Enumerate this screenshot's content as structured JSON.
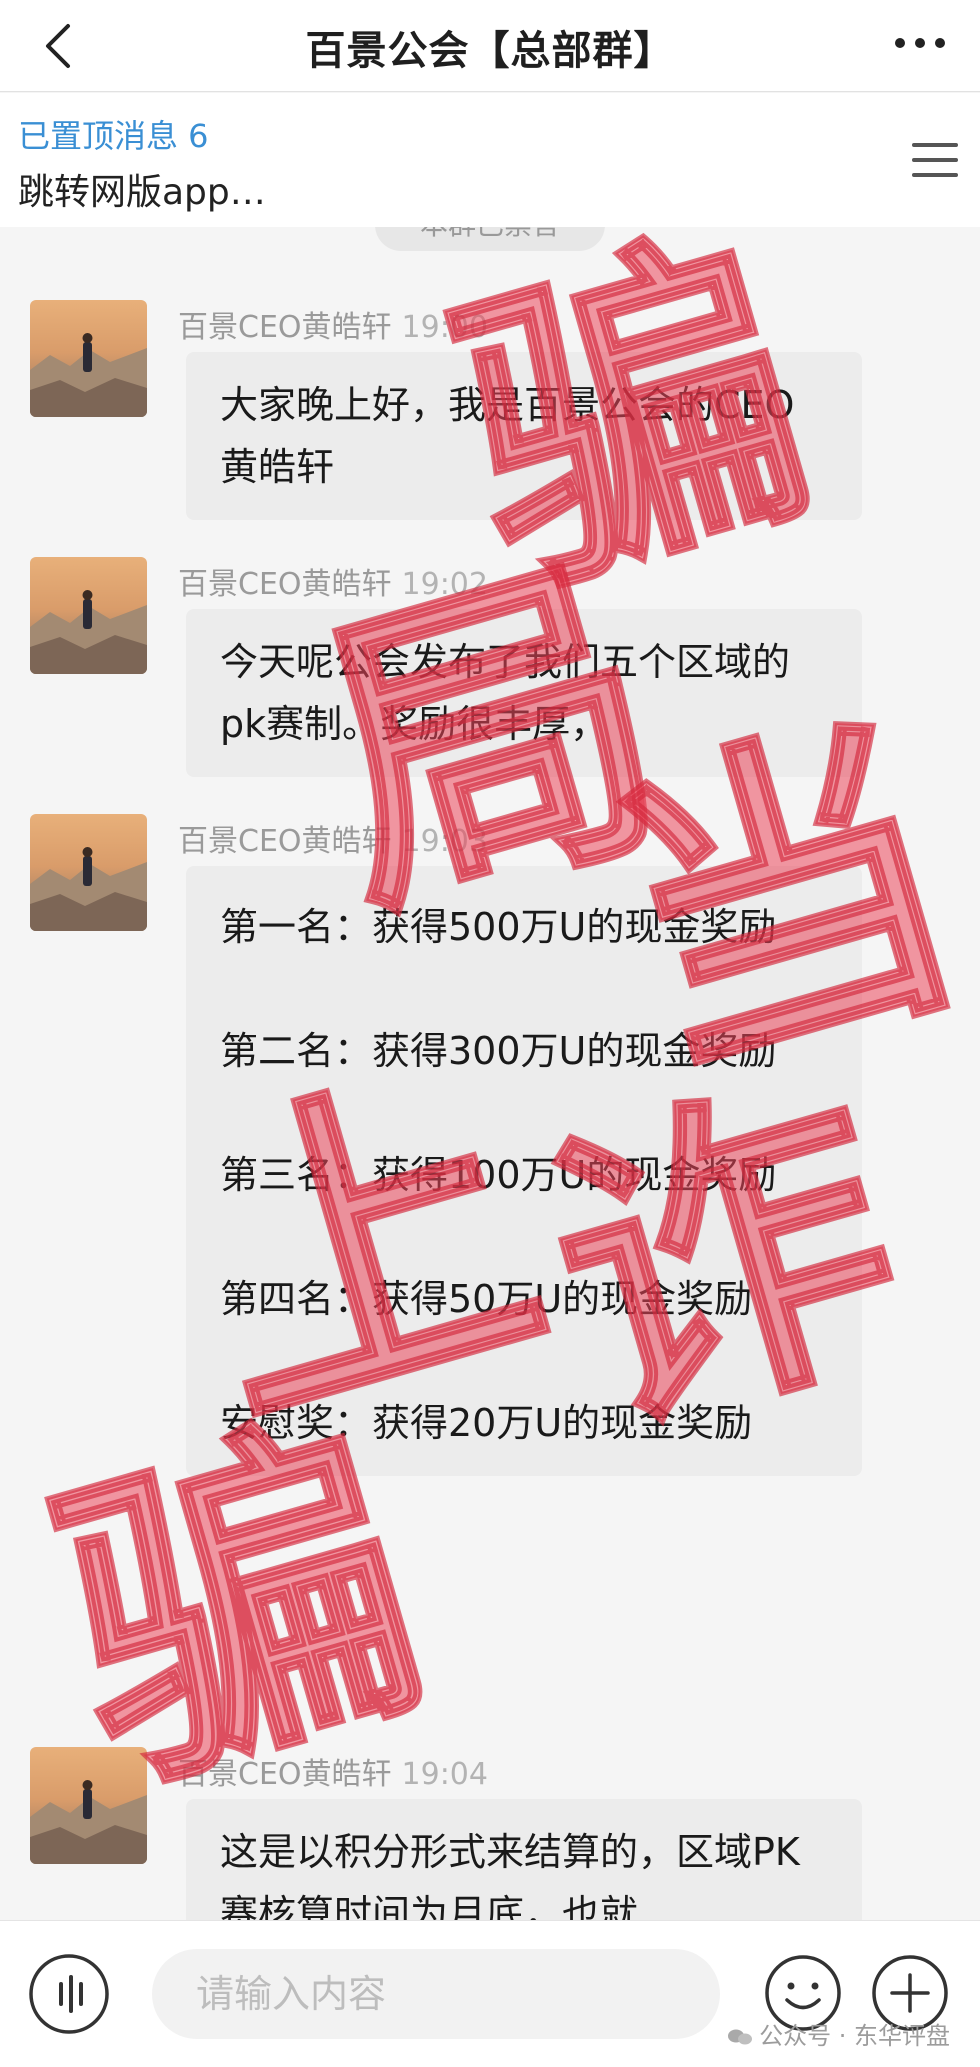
{
  "header": {
    "title": "百景公会【总部群】"
  },
  "pinned": {
    "label": "已置顶消息 6",
    "text": "跳转网版app…"
  },
  "chat": {
    "notice": "本群已禁言",
    "messages": [
      {
        "sender": "百景CEO黄皓轩",
        "time": "19:00",
        "paragraphs": [
          "大家晚上好，我是百景公会的CEO　黄皓轩"
        ]
      },
      {
        "sender": "百景CEO黄皓轩",
        "time": "19:02",
        "paragraphs": [
          "今天呢公会发布了我们五个区域的pk赛制。奖励很丰厚，"
        ]
      },
      {
        "sender": "百景CEO黄皓轩",
        "time": "19:03",
        "paragraphs": [
          "第一名：获得500万U的现金奖励",
          "第二名：获得300万U的现金奖励",
          "第三名：获得100万U的现金奖励",
          "第四名：获得50万U的现金奖励",
          "安慰奖：获得20万U的现金奖励"
        ]
      },
      {
        "sender": "百景CEO黄皓轩",
        "time": "19:04",
        "paragraphs": [
          "这是以积分形式来结算的，区域PK赛核算时间为月底，也就"
        ]
      }
    ]
  },
  "input": {
    "placeholder": "请输入内容"
  },
  "footer_watermark": "公众号 · 东华评盘",
  "stamp": {
    "chars": [
      "骗",
      "局",
      "上",
      "当",
      "诈",
      "骗"
    ],
    "color": "#e8465a"
  },
  "icons": {
    "back": "chevron-left-icon",
    "more": "more-dots-icon",
    "menu": "hamburger-menu-icon",
    "voice": "voice-wave-icon",
    "emoji": "smiley-icon",
    "plus": "plus-circle-icon"
  }
}
